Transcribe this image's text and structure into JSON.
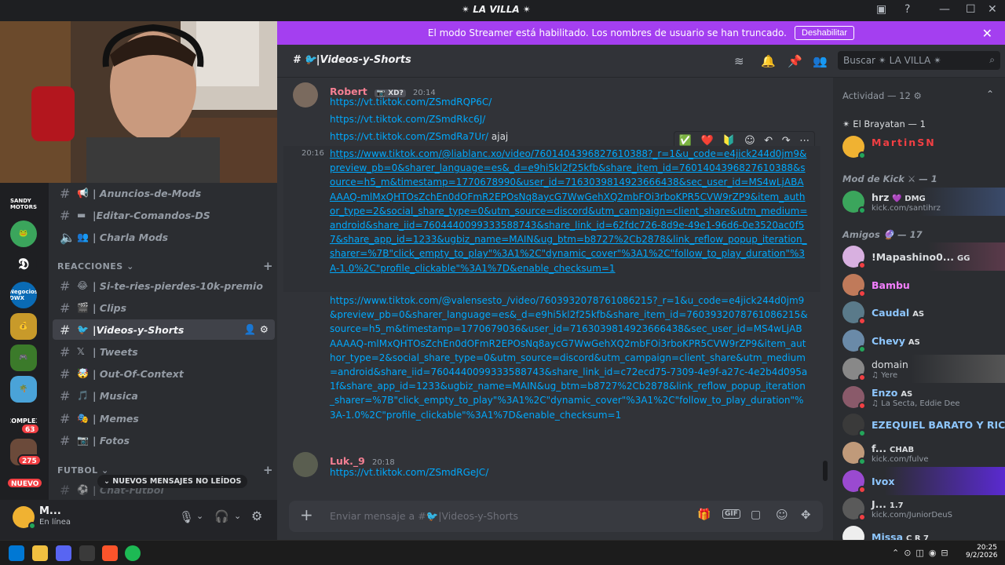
{
  "window": {
    "server_title": "LA VILLA"
  },
  "banner": {
    "text": "El modo Streamer está habilitado. Los nombres de usuario se han truncado.",
    "button": "Deshabilitar"
  },
  "rail": {
    "servers": [
      "SANDY MOTORS",
      "",
      "",
      "Negocios DWX",
      "",
      "",
      "",
      "COMPLEX",
      ""
    ],
    "badges": [
      "63",
      "275"
    ],
    "new_pill": "NUEVO",
    "unread_pill": "NUEVOS MENSAJES NO LEÍDOS"
  },
  "channels": {
    "top": [
      {
        "emoji": "📢",
        "name": "| Anuncios-de-Mods",
        "type": "hash"
      },
      {
        "emoji": "▬",
        "name": "|Editar-Comandos-DS",
        "type": "hash"
      },
      {
        "emoji": "👥",
        "name": "| Charla Mods",
        "type": "voice"
      }
    ],
    "cat_reacciones": "REACCIONES",
    "reacciones": [
      {
        "emoji": "😂",
        "name": "| Si-te-ries-pierdes-10k-premio"
      },
      {
        "emoji": "🎬",
        "name": "| Clips"
      },
      {
        "emoji": "🐦",
        "name": "|Videos-y-Shorts"
      },
      {
        "emoji": "𝕏",
        "name": "| Tweets"
      },
      {
        "emoji": "🤯",
        "name": "| Out-Of-Context"
      },
      {
        "emoji": "🎵",
        "name": "| Musica"
      },
      {
        "emoji": "🎭",
        "name": "| Memes"
      },
      {
        "emoji": "📷",
        "name": "| Fotos"
      }
    ],
    "cat_futbol": "FUTBOL",
    "futbol_partial": "| Chat-Futbol"
  },
  "user": {
    "name": "M...",
    "status": "En línea"
  },
  "chat": {
    "channel": "🐦|Videos-y-Shorts",
    "messages": [
      {
        "author": "Robert",
        "tag": "XD?",
        "time": "20:14",
        "lines": [
          {
            "link": "https://vt.tiktok.com/ZSmdRQP6C/",
            "suffix": ""
          },
          {
            "link": "https://vt.tiktok.com/ZSmdRkc6J/",
            "suffix": ""
          },
          {
            "link": "https://vt.tiktok.com/ZSmdRa7Ur/",
            "suffix": " ajaj"
          }
        ]
      }
    ],
    "hover_time": "20:16",
    "long_link_1": "https://www.tiktok.com/@liablanc.xo/video/7601404396827610388?_r=1&u_code=e4jick244d0jm9&preview_pb=0&sharer_language=es&_d=e9hi5kl2f25kfb&share_item_id=7601404396827610388&source=h5_m&timestamp=1770678990&user_id=7163039814923666438&sec_user_id=MS4wLjABAAAAQ-mlMxQHTOsZchEn0dOFmR2EPOsNq8aycG7WwGehXQ2mbFOi3rboKPR5CVW9rZP9&item_author_type=2&social_share_type=0&utm_source=discord&utm_campaign=client_share&utm_medium=android&share_iid=7604440099333588743&share_link_id=62fdc726-8d9e-49e1-96d6-0e3520ac0f57&share_app_id=1233&ugbiz_name=MAIN&ug_btm=b8727%2Cb2878&link_reflow_popup_iteration_sharer=%7B\"click_empty_to_play\"%3A1%2C\"dynamic_cover\"%3A1%2C\"follow_to_play_duration\"%3A-1.0%2C\"profile_clickable\"%3A1%7D&enable_checksum=1",
    "long_link_2": "https://www.tiktok.com/@valensesto_/video/7603932078761086215?_r=1&u_code=e4jick244d0jm9&preview_pb=0&sharer_language=es&_d=e9hi5kl2f25kfb&share_item_id=7603932078761086215&source=h5_m&timestamp=1770679036&user_id=7163039814923666438&sec_user_id=MS4wLjABAAAAQ-mlMxQHTOsZchEn0dOFmR2EPOsNq8aycG7WwGehXQ2mbFOi3rboKPR5CVW9rZP9&item_author_type=2&social_share_type=0&utm_source=discord&utm_campaign=client_share&utm_medium=android&share_iid=7604440099333588743&share_link_id=c72ecd75-7309-4e9f-a27c-4e2b4d095a1f&share_app_id=1233&ugbiz_name=MAIN&ug_btm=b8727%2Cb2878&link_reflow_popup_iteration_sharer=%7B\"click_empty_to_play\"%3A1%2C\"dynamic_cover\"%3A1%2C\"follow_to_play_duration\"%3A-1.0%2C\"profile_clickable\"%3A1%7D&enable_checksum=1",
    "msg2": {
      "author": "Luk._9",
      "time": "20:18",
      "link": "https://vt.tiktok.com/ZSmdRGeJC/"
    },
    "composer_placeholder": "Enviar mensaje a #🐦|Videos-y-Shorts"
  },
  "search": {
    "placeholder": "Buscar ✴ LA VILLA ✴"
  },
  "members": {
    "actividad": "Actividad — 12",
    "brayatan": "El Brayatan — 1",
    "martin": "MartinSN",
    "modkick": "Mod de Kick ⚔ — 1",
    "hrz": {
      "name": "hrz",
      "tag": "DMG",
      "sub": "kick.com/santihrz"
    },
    "amigos": "Amigos 🔮 — 17",
    "list": [
      {
        "name": "!Mapashino0...",
        "tag": "GG",
        "sub": "",
        "color": "#dbdee1"
      },
      {
        "name": "Bambu",
        "tag": "",
        "sub": "",
        "color": "#f47fff"
      },
      {
        "name": "Caudal",
        "tag": "AS",
        "sub": "",
        "color": "#8ec7ff"
      },
      {
        "name": "Chevy",
        "tag": "AS",
        "sub": "",
        "color": "#8ec7ff"
      },
      {
        "name": "domain",
        "tag": "",
        "sub": "♫ Yere",
        "color": "#dbdee1"
      },
      {
        "name": "Enzo",
        "tag": "AS",
        "sub": "♫ La Secta, Eddie Dee",
        "color": "#8ec7ff"
      },
      {
        "name": "EZEQUIEL BARATO Y RICO",
        "tag": "",
        "sub": "",
        "color": "#8ec7ff"
      },
      {
        "name": "f...",
        "tag": "CHAB",
        "sub": "kick.com/fulve",
        "color": "#dbdee1"
      },
      {
        "name": "Ivox",
        "tag": "",
        "sub": "",
        "color": "#8ec7ff"
      },
      {
        "name": "J...",
        "tag": "1.7",
        "sub": "kick.com/JuniorDeuS",
        "color": "#dbdee1"
      },
      {
        "name": "Missa",
        "tag": "C R 7",
        "sub": "",
        "color": "#8ec7ff"
      }
    ]
  },
  "taskbar": {
    "time": "20:25",
    "date": "9/2/2026"
  },
  "colors": {
    "accent": "#a43ff0",
    "link": "#00a8fc",
    "online": "#23a55a",
    "dnd": "#f23f43"
  }
}
